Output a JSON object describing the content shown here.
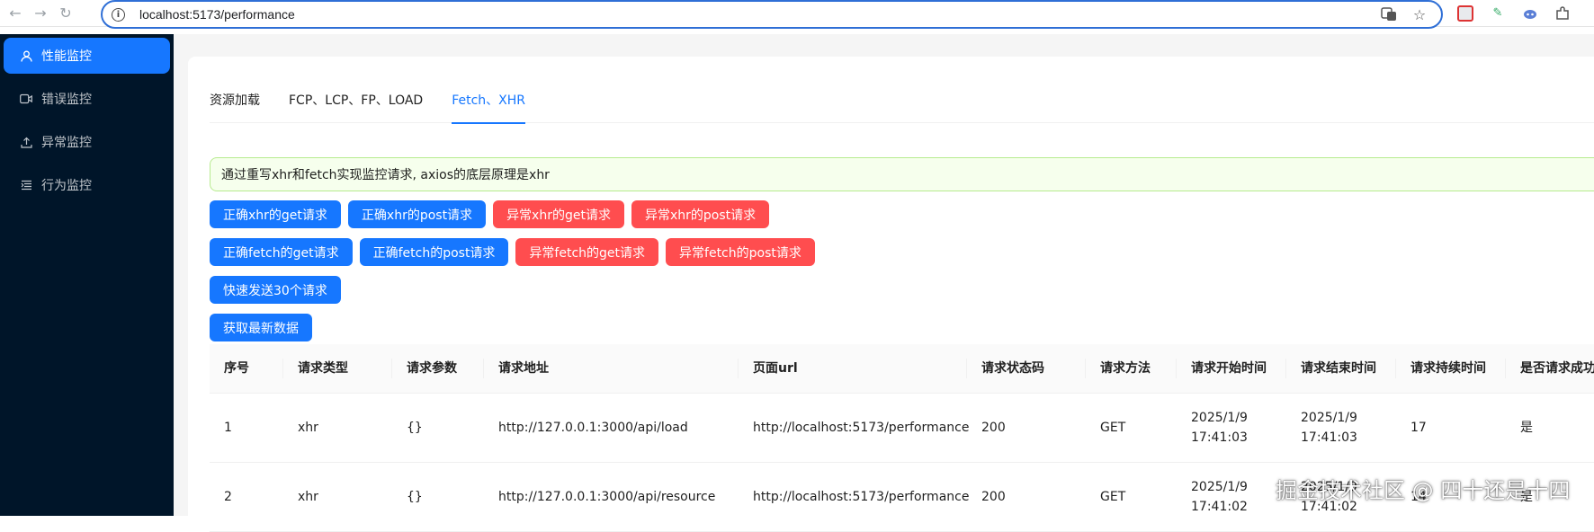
{
  "browser": {
    "url": "localhost:5173/performance"
  },
  "sidebar": {
    "items": [
      {
        "label": "性能监控",
        "icon": "user-icon",
        "active": true
      },
      {
        "label": "错误监控",
        "icon": "video-icon",
        "active": false
      },
      {
        "label": "异常监控",
        "icon": "upload-icon",
        "active": false
      },
      {
        "label": "行为监控",
        "icon": "list-icon",
        "active": false
      }
    ]
  },
  "tabs": [
    {
      "label": "资源加载",
      "active": false
    },
    {
      "label": "FCP、LCP、FP、LOAD",
      "active": false
    },
    {
      "label": "Fetch、XHR",
      "active": true
    }
  ],
  "alert": {
    "text": "通过重写xhr和fetch实现监控请求, axios的底层原理是xhr"
  },
  "buttons": {
    "row1": [
      {
        "label": "正确xhr的get请求",
        "type": "primary"
      },
      {
        "label": "正确xhr的post请求",
        "type": "primary"
      },
      {
        "label": "异常xhr的get请求",
        "type": "danger"
      },
      {
        "label": "异常xhr的post请求",
        "type": "danger"
      }
    ],
    "row2": [
      {
        "label": "正确fetch的get请求",
        "type": "primary"
      },
      {
        "label": "正确fetch的post请求",
        "type": "primary"
      },
      {
        "label": "异常fetch的get请求",
        "type": "danger"
      },
      {
        "label": "异常fetch的post请求",
        "type": "danger"
      }
    ],
    "row3": [
      {
        "label": "快速发送30个请求",
        "type": "primary"
      }
    ],
    "row4": [
      {
        "label": "获取最新数据",
        "type": "primary"
      }
    ]
  },
  "table": {
    "columns": [
      "序号",
      "请求类型",
      "请求参数",
      "请求地址",
      "页面url",
      "请求状态码",
      "请求方法",
      "请求开始时间",
      "请求结束时间",
      "请求持续时间",
      "是否请求成功"
    ],
    "rows": [
      [
        "1",
        "xhr",
        "{}",
        "http://127.0.0.1:3000/api/load",
        "http://localhost:5173/performance",
        "200",
        "GET",
        "2025/1/9 17:41:03",
        "2025/1/9 17:41:03",
        "17",
        "是"
      ],
      [
        "2",
        "xhr",
        "{}",
        "http://127.0.0.1:3000/api/resource",
        "http://localhost:5173/performance",
        "200",
        "GET",
        "2025/1/9 17:41:02",
        "2025/1/9 17:41:02",
        "14",
        "是"
      ]
    ]
  },
  "watermark": "掘金技术社区 @ 四十还是十四",
  "colors": {
    "primary": "#1677ff",
    "danger": "#ff4d4f",
    "sidebar_bg": "#001529",
    "alert_bg": "#f6ffed"
  }
}
